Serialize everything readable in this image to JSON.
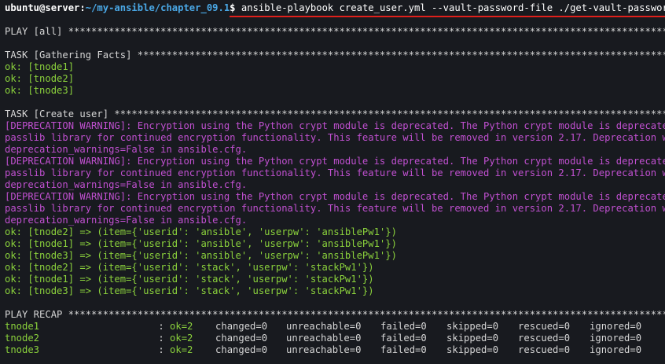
{
  "prompt": {
    "user": "ubuntu@server",
    "sep": ":",
    "path": "~/my-ansible/chapter_09.1",
    "symbol": "$",
    "command": " ansible-playbook create_user.yml --vault-password-file ./get-vault-password.sh"
  },
  "play_header": "PLAY [all] ***********************************************************************************************************",
  "task1_header": "TASK [Gathering Facts] ***********************************************************************************************",
  "task1_lines": [
    "ok: [tnode1]",
    "ok: [tnode2]",
    "ok: [tnode3]"
  ],
  "task2_header": "TASK [Create user] ***************************************************************************************************",
  "warnings": [
    {
      "l1": "[DEPRECATION WARNING]: Encryption using the Python crypt module is deprecated. The Python crypt module is deprecated and",
      "l2": "passlib library for continued encryption functionality. This feature will be removed in version 2.17. Deprecation warnin",
      "l3": "deprecation_warnings=False in ansible.cfg."
    },
    {
      "l1": "[DEPRECATION WARNING]: Encryption using the Python crypt module is deprecated. The Python crypt module is deprecated and",
      "l2": "passlib library for continued encryption functionality. This feature will be removed in version 2.17. Deprecation warnin",
      "l3": "deprecation_warnings=False in ansible.cfg."
    },
    {
      "l1": "[DEPRECATION WARNING]: Encryption using the Python crypt module is deprecated. The Python crypt module is deprecated and",
      "l2": "passlib library for continued encryption functionality. This feature will be removed in version 2.17. Deprecation warnin",
      "l3": "deprecation_warnings=False in ansible.cfg."
    }
  ],
  "task2_lines": [
    "ok: [tnode2] => (item={'userid': 'ansible', 'userpw': 'ansiblePw1'})",
    "ok: [tnode1] => (item={'userid': 'ansible', 'userpw': 'ansiblePw1'})",
    "ok: [tnode3] => (item={'userid': 'ansible', 'userpw': 'ansiblePw1'})",
    "ok: [tnode2] => (item={'userid': 'stack', 'userpw': 'stackPw1'})",
    "ok: [tnode1] => (item={'userid': 'stack', 'userpw': 'stackPw1'})",
    "ok: [tnode3] => (item={'userid': 'stack', 'userpw': 'stackPw1'})"
  ],
  "recap_header": "PLAY RECAP ***********************************************************************************************************",
  "recap": [
    {
      "host": "tnode1",
      "sep": " : ",
      "ok": "ok=2",
      "changed": "changed=0",
      "unreachable": "unreachable=0",
      "failed": "failed=0",
      "skipped": "skipped=0",
      "rescued": "rescued=0",
      "ignored": "ignored=0"
    },
    {
      "host": "tnode2",
      "sep": " : ",
      "ok": "ok=2",
      "changed": "changed=0",
      "unreachable": "unreachable=0",
      "failed": "failed=0",
      "skipped": "skipped=0",
      "rescued": "rescued=0",
      "ignored": "ignored=0"
    },
    {
      "host": "tnode3",
      "sep": " : ",
      "ok": "ok=2",
      "changed": "changed=0",
      "unreachable": "unreachable=0",
      "failed": "failed=0",
      "skipped": "skipped=0",
      "rescued": "rescued=0",
      "ignored": "ignored=0"
    }
  ],
  "colors": {
    "background": "#181a1f",
    "ok": "#8bd23c",
    "warning": "#c050d0",
    "path": "#4aa8e6",
    "highlight_underline": "#e0201b"
  }
}
